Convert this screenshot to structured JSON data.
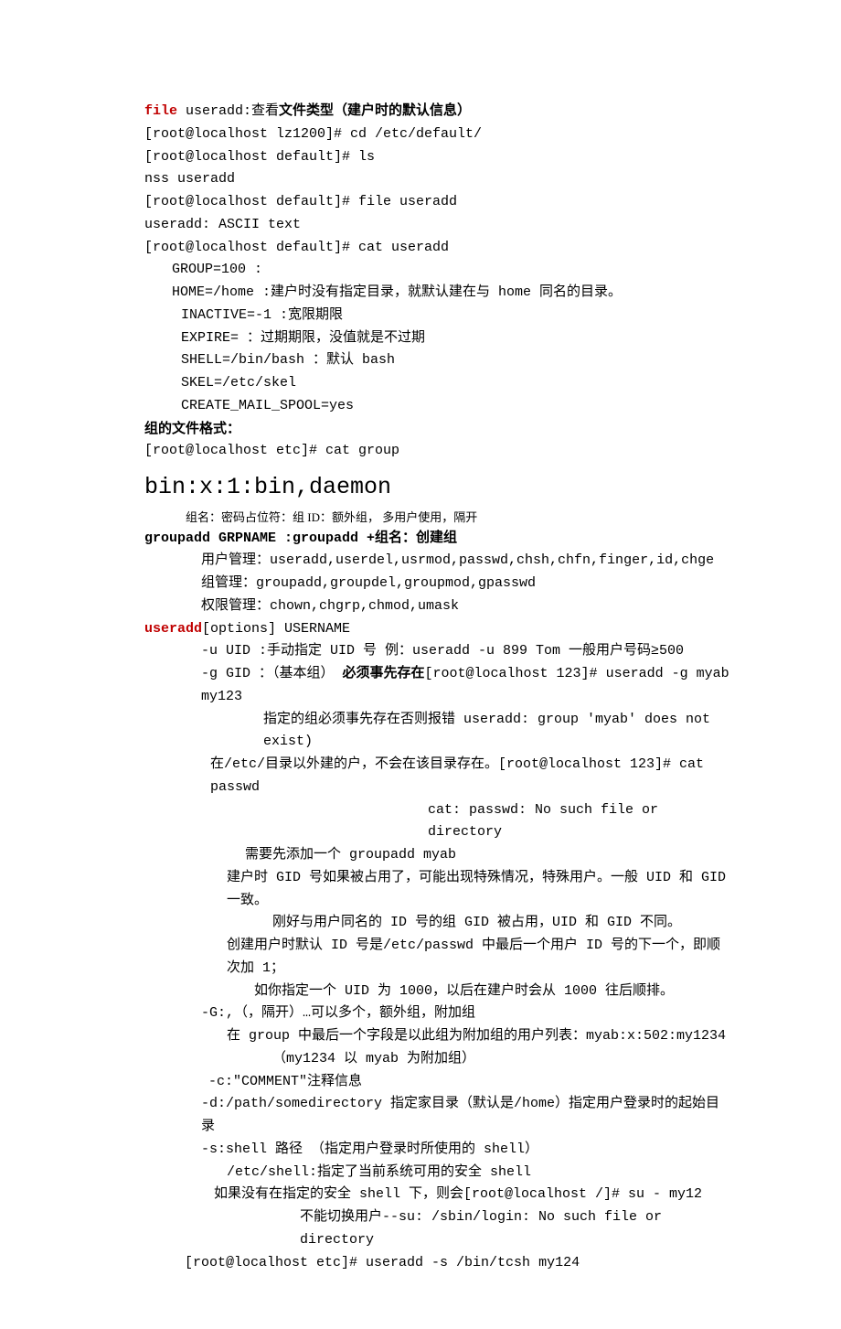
{
  "l1a": "file",
  "l1b": " useradd:查看",
  "l1c": "文件类型（建户时的默认信息）",
  "l2": "[root@localhost lz1200]# cd /etc/default/",
  "l3": "[root@localhost default]# ls",
  "l4": "nss  useradd",
  "l5": "[root@localhost default]# file useradd",
  "l6": "useradd: ASCII text",
  "l7": "[root@localhost default]# cat useradd",
  "l8": "GROUP=100 :",
  "l9": "HOME=/home :建户时没有指定目录，就默认建在与 home 同名的目录。",
  "l10": "INACTIVE=-1 :宽限期限",
  "l11": "EXPIRE= ：过期期限，没值就是不过期",
  "l12": "SHELL=/bin/bash  ：默认 bash",
  "l13": "SKEL=/etc/skel",
  "l14": "CREATE_MAIL_SPOOL=yes",
  "l15": "组的文件格式：",
  "l16": "[root@localhost etc]# cat group",
  "l17": "bin:x:1:bin,daemon",
  "l18": "组名：密码占位符：组 ID：额外组，      多用户使用，隔开",
  "l19a": "groupadd GRPNAME :groupadd +组名：创建组",
  "l20": "用户管理：useradd,userdel,usrmod,passwd,chsh,chfn,finger,id,chge",
  "l21": "组管理：groupadd,groupdel,groupmod,gpasswd",
  "l22": "权限管理：chown,chgrp,chmod,umask",
  "l23a": "useradd",
  "l23b": "[options] USERNAME",
  "l24": "-u UID :手动指定 UID 号  例：useradd -u 899 Tom  一般用户号码≥500",
  "l25a": "-g GID ：（基本组） ",
  "l25b": "必须事先存在",
  "l25c": "[root@localhost 123]# useradd -g myab my123",
  "l26": "指定的组必须事先存在否则报错 useradd: group 'myab' does not exist)",
  "l27": "在/etc/目录以外建的户，不会在该目录存在。[root@localhost 123]# cat passwd",
  "l28": "cat: passwd: No such file or directory",
  "l29": "需要先添加一个 groupadd myab",
  "l30": "建户时 GID 号如果被占用了，可能出现特殊情况，特殊用户。一般 UID 和 GID 一致。",
  "l31": "刚好与用户同名的 ID 号的组 GID 被占用，UID 和 GID 不同。",
  "l32": "创建用户时默认 ID 号是/etc/passwd 中最后一个用户 ID 号的下一个，即顺次加 1；",
  "l33": "如你指定一个 UID 为 1000，以后在建户时会从 1000 往后顺排。",
  "l34": "-G:,（，隔开）…可以多个，额外组，附加组",
  "l35": "在 group 中最后一个字段是以此组为附加组的用户列表：myab:x:502:my1234",
  "l36": "（my1234 以 myab 为附加组）",
  "l37": "-c:\"COMMENT\"注释信息",
  "l38": "-d:/path/somedirectory  指定家目录（默认是/home）指定用户登录时的起始目录",
  "l39": "-s:shell 路径 （指定用户登录时所使用的 shell）",
  "l40": "/etc/shell:指定了当前系统可用的安全 shell",
  "l41": "如果没有在指定的安全 shell 下，则会[root@localhost /]# su - my12",
  "l42": "不能切换用户--su: /sbin/login: No such file or directory",
  "l43": "[root@localhost etc]# useradd -s /bin/tcsh my124"
}
